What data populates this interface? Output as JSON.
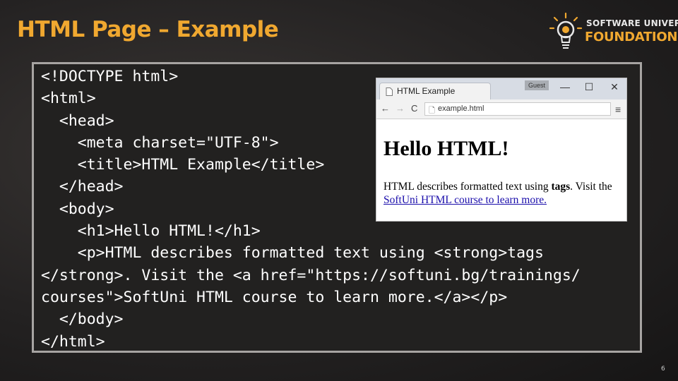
{
  "slide": {
    "title": "HTML Page – Example",
    "page_number": "6"
  },
  "logo": {
    "line1": "SOFTWARE UNIVERSITY",
    "line2": "FOUNDATION",
    "accent_color": "#f0a830"
  },
  "code": {
    "lines": [
      "<!DOCTYPE html>",
      "<html>",
      "  <head>",
      "    <meta charset=\"UTF-8\">",
      "    <title>HTML Example</title>",
      "  </head>",
      "  <body>",
      "    <h1>Hello HTML!</h1>",
      "    <p>HTML describes formatted text using <strong>tags",
      "</strong>. Visit the <a href=\"https://softuni.bg/trainings/",
      "courses\">SoftUni HTML course to learn more.</a></p>",
      "  </body>",
      "</html>"
    ]
  },
  "browser": {
    "tab_title": "HTML Example",
    "guest_label": "Guest",
    "address": "example.html",
    "controls": {
      "minimize": "—",
      "maximize": "☐",
      "close": "✕"
    },
    "nav": {
      "back": "←",
      "forward": "→",
      "reload": "C",
      "menu": "≡",
      "page_icon": "🗋"
    },
    "content": {
      "heading": "Hello HTML!",
      "para_before": "HTML describes formatted text using ",
      "para_strong": "tags",
      "para_middle": ". Visit the ",
      "link_text": "SoftUni HTML course to learn more."
    }
  }
}
